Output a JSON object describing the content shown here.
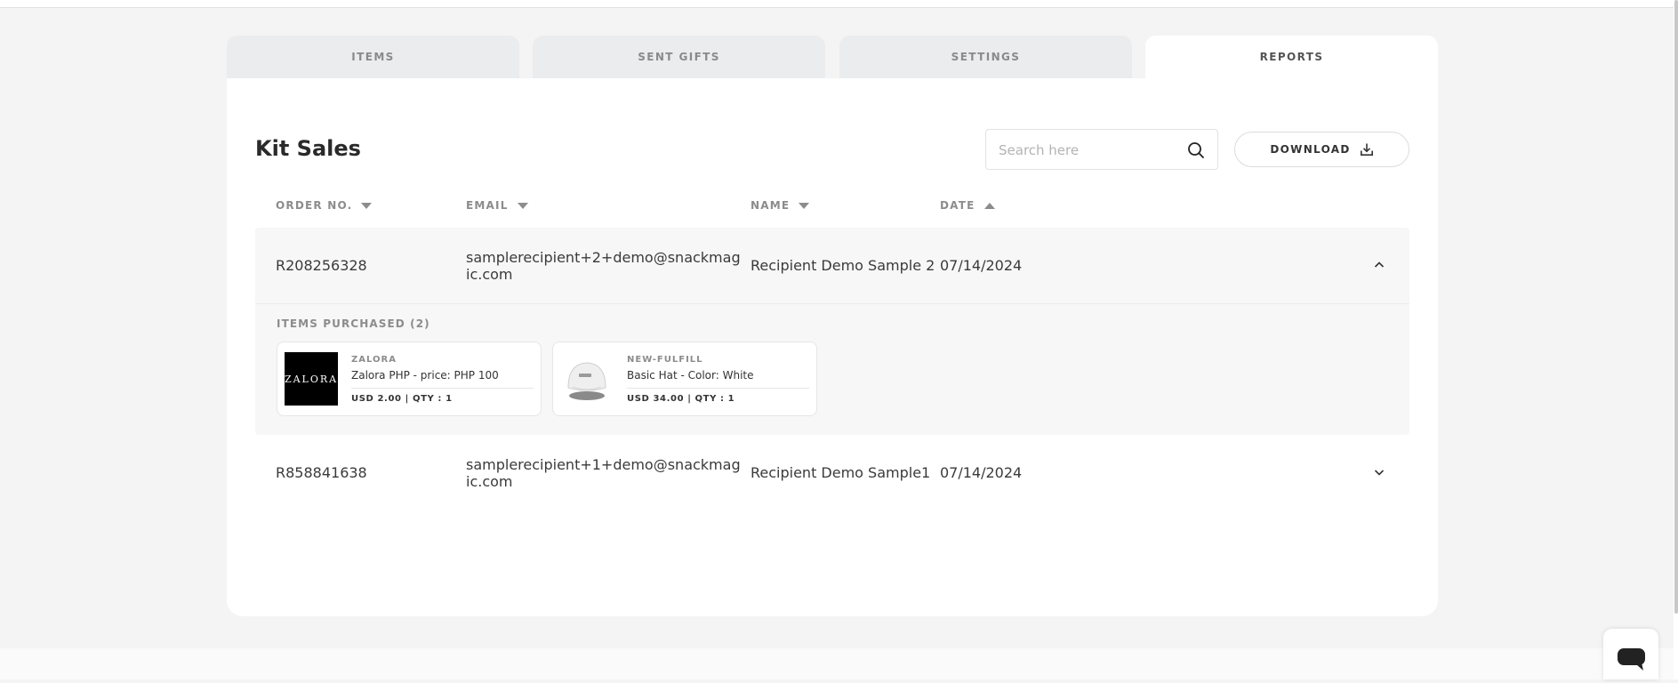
{
  "tabs": [
    "ITEMS",
    "SENT GIFTS",
    "SETTINGS",
    "REPORTS"
  ],
  "active_tab": "REPORTS",
  "page_title": "Kit Sales",
  "search": {
    "placeholder": "Search here",
    "value": ""
  },
  "download_label": "DOWNLOAD",
  "columns": [
    {
      "label": "ORDER NO.",
      "sort": "desc"
    },
    {
      "label": "EMAIL",
      "sort": "desc"
    },
    {
      "label": "NAME",
      "sort": "desc"
    },
    {
      "label": "DATE",
      "sort": "asc"
    }
  ],
  "orders": [
    {
      "order_no": "R208256328",
      "email": "samplerecipient+2+demo@snackmagic.com",
      "name": "Recipient Demo Sample 2",
      "date": "07/14/2024",
      "expanded": true,
      "items_label": "ITEMS PURCHASED (2)",
      "items": [
        {
          "brand": "ZALORA",
          "name": "Zalora PHP - price: PHP 100",
          "meta": "USD 2.00 | QTY : 1",
          "thumb_text": "ZALORA"
        },
        {
          "brand": "NEW-FULFILL",
          "name": "Basic Hat - Color: White",
          "meta": "USD 34.00 | QTY : 1"
        }
      ]
    },
    {
      "order_no": "R858841638",
      "email": "samplerecipient+1+demo@snackmagic.com",
      "name": "Recipient Demo Sample1",
      "date": "07/14/2024",
      "expanded": false
    }
  ],
  "icons": {
    "search": "search-icon",
    "download": "download-icon",
    "expand": "chevron-up-icon",
    "collapse": "chevron-down-icon",
    "chat": "chat-icon"
  },
  "colors": {
    "background": "#f4f4f4",
    "tab_inactive": "#ebecee",
    "panel": "#ffffff",
    "expanded_row": "#f7f7f7",
    "muted_text": "#8c8c8c"
  }
}
